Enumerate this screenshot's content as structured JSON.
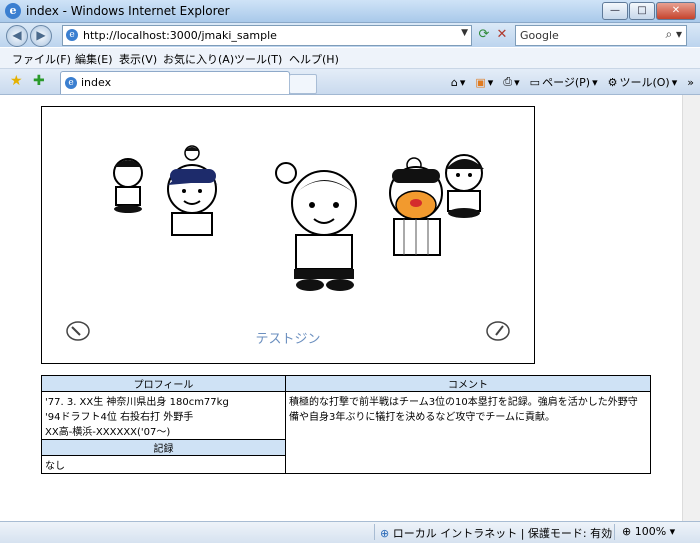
{
  "window": {
    "title": "index - Windows Internet Explorer"
  },
  "address": {
    "url": "http://localhost:3000/jmaki_sample"
  },
  "search": {
    "placeholder": "Google"
  },
  "menu": [
    "ファイル(F)",
    "編集(E)",
    "表示(V)",
    "お気に入り(A)",
    "ツール(T)",
    "ヘルプ(H)"
  ],
  "tab": {
    "label": "index"
  },
  "commands": {
    "page": "ページ(P)",
    "tools": "ツール(O)"
  },
  "gallery": {
    "caption": "テストジン"
  },
  "profile": {
    "profile_header": "プロフィール",
    "comment_header": "コメント",
    "profile_lines": [
      "'77. 3. XX生  神奈川県出身  180cm77kg",
      "'94ドラフト4位  右投右打  外野手",
      "XX高-横浜-XXXXXX('07〜)"
    ],
    "comment_text": "積極的な打撃で前半戦はチーム3位の10本塁打を記録。強肩を活かした外野守備や自身3年ぶりに犠打を決めるなど攻守でチームに貢献。",
    "record_header": "記録",
    "record_value": "なし"
  },
  "status": {
    "zone": "ローカル イントラネット | 保護モード: 有効",
    "zoom": "100%"
  }
}
